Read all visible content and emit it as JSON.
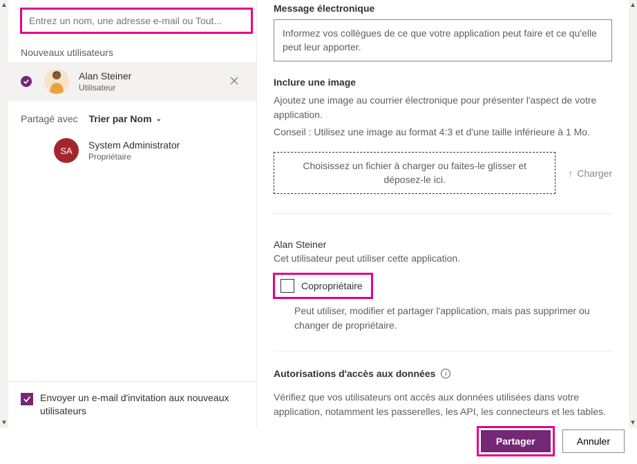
{
  "search": {
    "placeholder": "Entrez un nom, une adresse e-mail ou Tout..."
  },
  "sections": {
    "newUsersLabel": "Nouveaux utilisateurs",
    "sharedWithLabel": "Partagé avec",
    "sortLabel": "Trier par Nom"
  },
  "newUsers": [
    {
      "name": "Alan Steiner",
      "role": "Utilisateur"
    }
  ],
  "sharedWith": [
    {
      "initials": "SA",
      "name": "System Administrator",
      "role": "Propriétaire"
    }
  ],
  "inviteCheckbox": {
    "checked": true,
    "label": "Envoyer un e-mail d'invitation aux nouveaux utilisateurs"
  },
  "rightPanel": {
    "emailHeading": "Message électronique",
    "emailPlaceholder": "Informez vos collègues de ce que votre application peut faire et ce qu'elle peut leur apporter.",
    "imageHeading": "Inclure une image",
    "imageDesc": "Ajoutez une image au courrier électronique pour présenter l'aspect de votre application.",
    "imageTip": "Conseil : Utilisez une image au format 4:3 et d'une taille inférieure à 1 Mo.",
    "dropzone": "Choisissez un fichier à charger ou faites-le glisser et déposez-le ici.",
    "uploadLabel": "Charger",
    "permUserName": "Alan Steiner",
    "permUserDesc": "Cet utilisateur peut utiliser cette application.",
    "coOwnerLabel": "Copropriétaire",
    "coOwnerExplain": "Peut utiliser, modifier et partager l'application, mais pas supprimer ou changer de propriétaire.",
    "dataAccessHeading": "Autorisations d'accès aux données",
    "dataAccessDesc": "Vérifiez que vos utilisateurs ont accès aux données utilisées dans votre application, notamment les passerelles, les API, les connecteurs et les tables."
  },
  "footer": {
    "primary": "Partager",
    "secondary": "Annuler"
  }
}
